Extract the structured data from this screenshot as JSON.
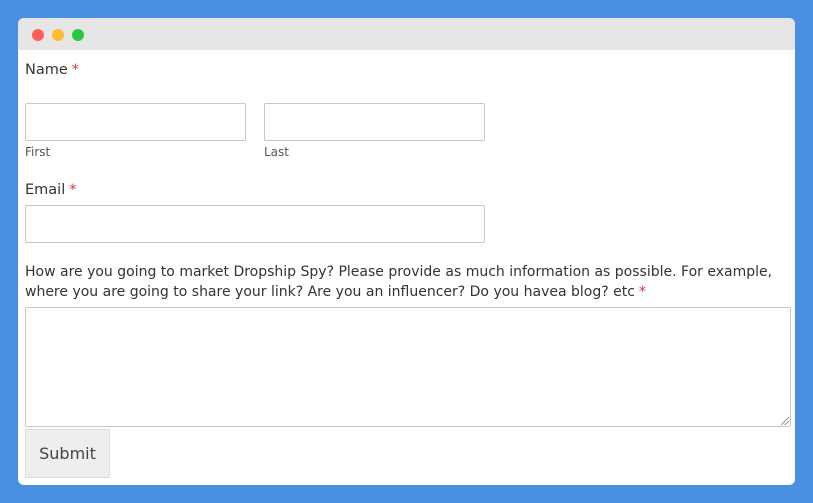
{
  "window": {
    "controls": {
      "close_color": "#ff5f57",
      "minimize_color": "#febc2e",
      "zoom_color": "#28c840"
    }
  },
  "form": {
    "name": {
      "label": "Name",
      "required_mark": "*",
      "first": {
        "value": "",
        "sublabel": "First"
      },
      "last": {
        "value": "",
        "sublabel": "Last"
      }
    },
    "email": {
      "label": "Email",
      "required_mark": "*",
      "value": ""
    },
    "marketing": {
      "question_line1": "How are you going to market Dropship Spy? Please provide as much information as possible. For example,",
      "question_line2": "where you are going to share your link? Are you an influencer? Do you havea blog? etc",
      "required_mark": "*",
      "value": ""
    },
    "submit_label": "Submit"
  },
  "colors": {
    "background": "#4a90e2",
    "required": "#d63638"
  }
}
